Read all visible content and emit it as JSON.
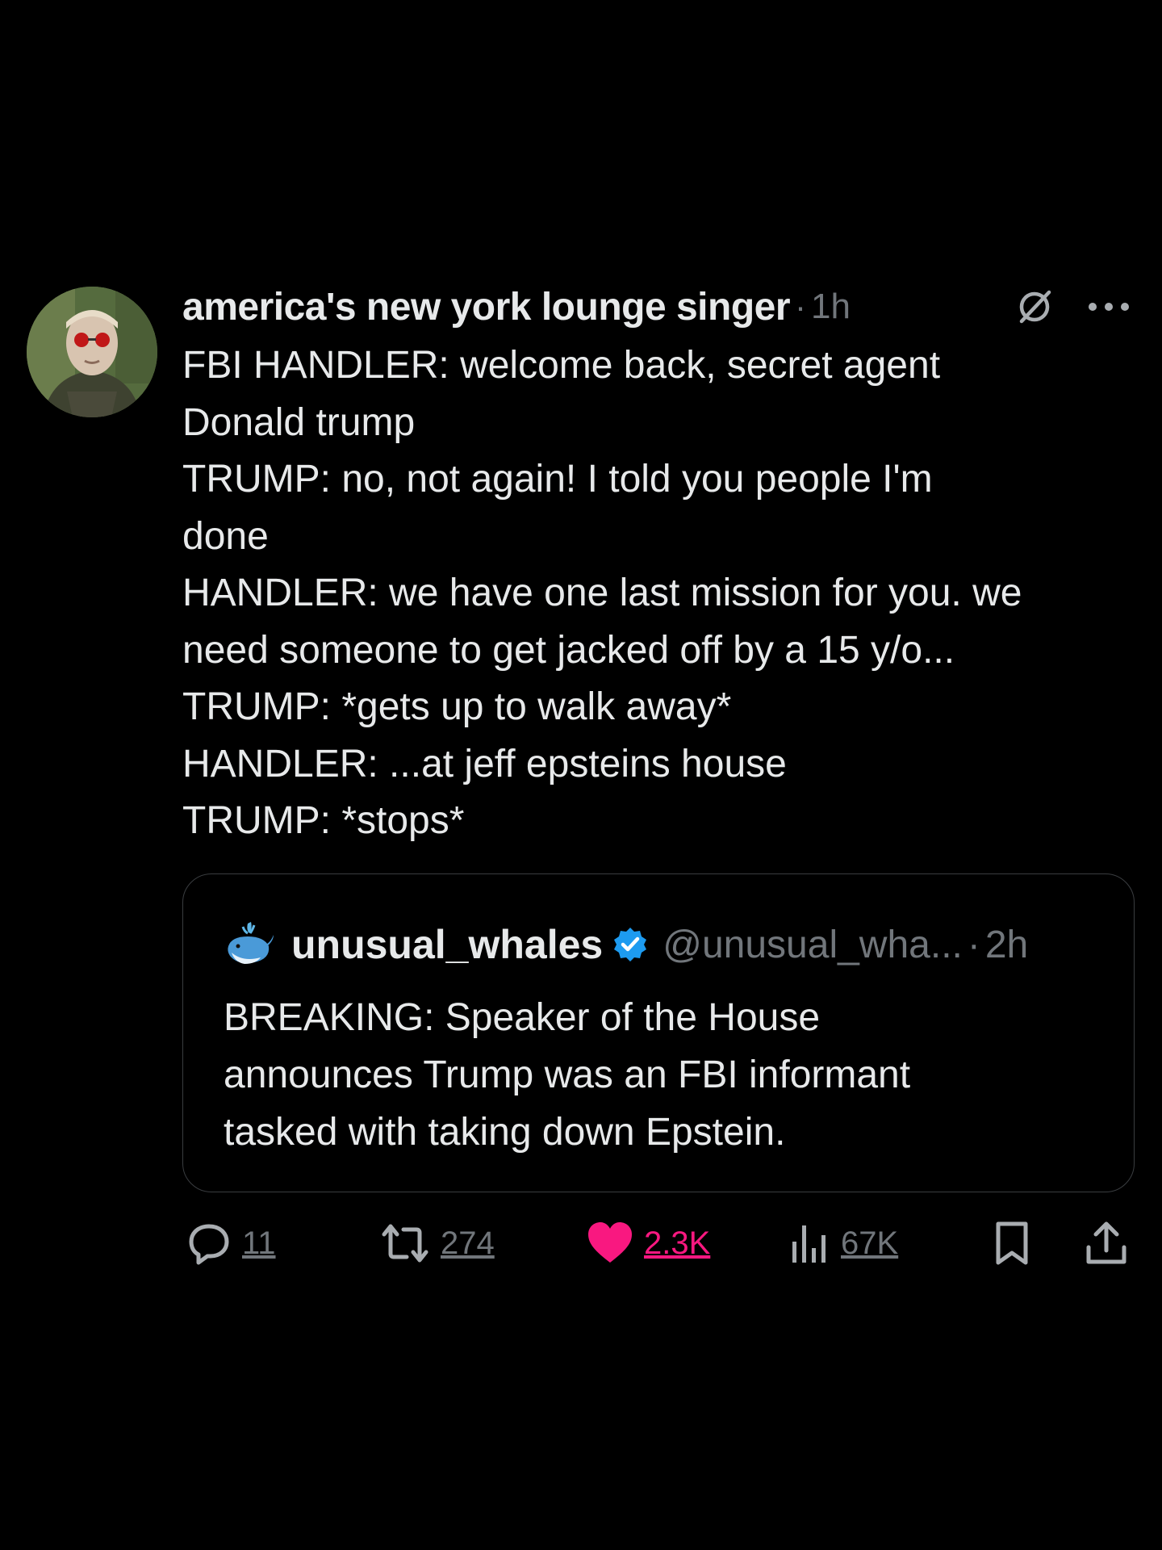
{
  "tweet": {
    "author_name": "america's new york lounge singer",
    "separator": "·",
    "time": "1h",
    "text_lines": [
      "FBI HANDLER: welcome back, secret agent",
      "Donald trump",
      "TRUMP: no, not again! I told you people I'm",
      "done",
      "HANDLER: we have one last mission for you. we",
      "need someone to get jacked off by a 15 y/o...",
      "TRUMP: *gets up to walk away*",
      "HANDLER: ...at jeff epsteins house",
      "TRUMP: *stops*"
    ]
  },
  "quote": {
    "name": "unusual_whales",
    "handle": "@unusual_wha...",
    "separator": "·",
    "time": "2h",
    "text_lines": [
      "BREAKING: Speaker of the House",
      "announces Trump was an FBI informant",
      "tasked with taking down Epstein."
    ]
  },
  "actions": {
    "replies": "11",
    "reposts": "274",
    "likes": "2.3K",
    "views": "67K"
  },
  "icons": {
    "grok": "grok-icon",
    "more": "more-icon",
    "verified": "verified-icon",
    "reply": "reply-icon",
    "repost": "repost-icon",
    "like": "heart-icon",
    "views": "views-icon",
    "bookmark": "bookmark-icon",
    "share": "share-icon"
  },
  "colors": {
    "background": "#000000",
    "text": "#e7e9ea",
    "secondary": "#71767b",
    "like": "#f91880",
    "verified": "#1d9bf0"
  }
}
